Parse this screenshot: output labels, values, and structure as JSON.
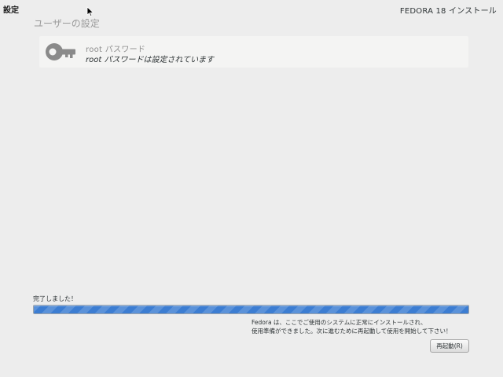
{
  "header": {
    "title": "設定",
    "product": "FEDORA 18 インストール"
  },
  "user_settings": {
    "section_title": "ユーザーの設定",
    "root_password": {
      "title": "root パスワード",
      "status": "root パスワードは設定されています",
      "icon": "key-icon"
    }
  },
  "progress": {
    "label": "完了しました！",
    "percent": 100,
    "color": "#3c7dd2"
  },
  "message": {
    "line1": "Fedora は、ここでご使用のシステムに正常にインストールされ、",
    "line2": "使用準備ができました。次に進むために再起動して使用を開始して下さい！"
  },
  "actions": {
    "reboot_label": "再起動(R)"
  }
}
